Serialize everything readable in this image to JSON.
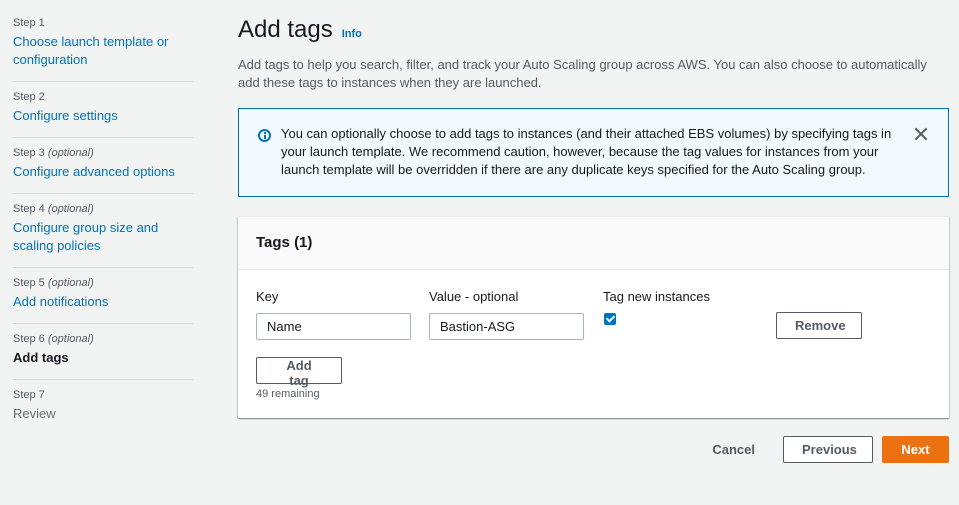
{
  "sidebar": {
    "steps": [
      {
        "num": "Step 1",
        "optional": "",
        "title": "Choose launch template or configuration"
      },
      {
        "num": "Step 2",
        "optional": "",
        "title": "Configure settings"
      },
      {
        "num": "Step 3",
        "optional": "(optional)",
        "title": "Configure advanced options"
      },
      {
        "num": "Step 4",
        "optional": "(optional)",
        "title": "Configure group size and scaling policies"
      },
      {
        "num": "Step 5",
        "optional": "(optional)",
        "title": "Add notifications"
      },
      {
        "num": "Step 6",
        "optional": "(optional)",
        "title": "Add tags"
      },
      {
        "num": "Step 7",
        "optional": "",
        "title": "Review"
      }
    ]
  },
  "main": {
    "title": "Add tags",
    "info": "Info",
    "description": "Add tags to help you search, filter, and track your Auto Scaling group across AWS. You can also choose to automatically add these tags to instances when they are launched.",
    "alert": "You can optionally choose to add tags to instances (and their attached EBS volumes) by specifying tags in your launch template. We recommend caution, however, because the tag values for instances from your launch template will be overridden if there are any duplicate keys specified for the Auto Scaling group."
  },
  "tags_panel": {
    "title": "Tags (1)",
    "key_label": "Key",
    "value_label": "Value - optional",
    "tag_new_label": "Tag new instances",
    "key_value": "Name",
    "value_value": "Bastion-ASG",
    "tag_new_checked": true,
    "remove_label": "Remove",
    "add_tag_label": "Add tag",
    "remaining": "49 remaining"
  },
  "footer": {
    "cancel": "Cancel",
    "previous": "Previous",
    "next": "Next"
  },
  "colors": {
    "link": "#0073bb",
    "primary": "#ec7211",
    "alert_bg": "#f1faff"
  }
}
